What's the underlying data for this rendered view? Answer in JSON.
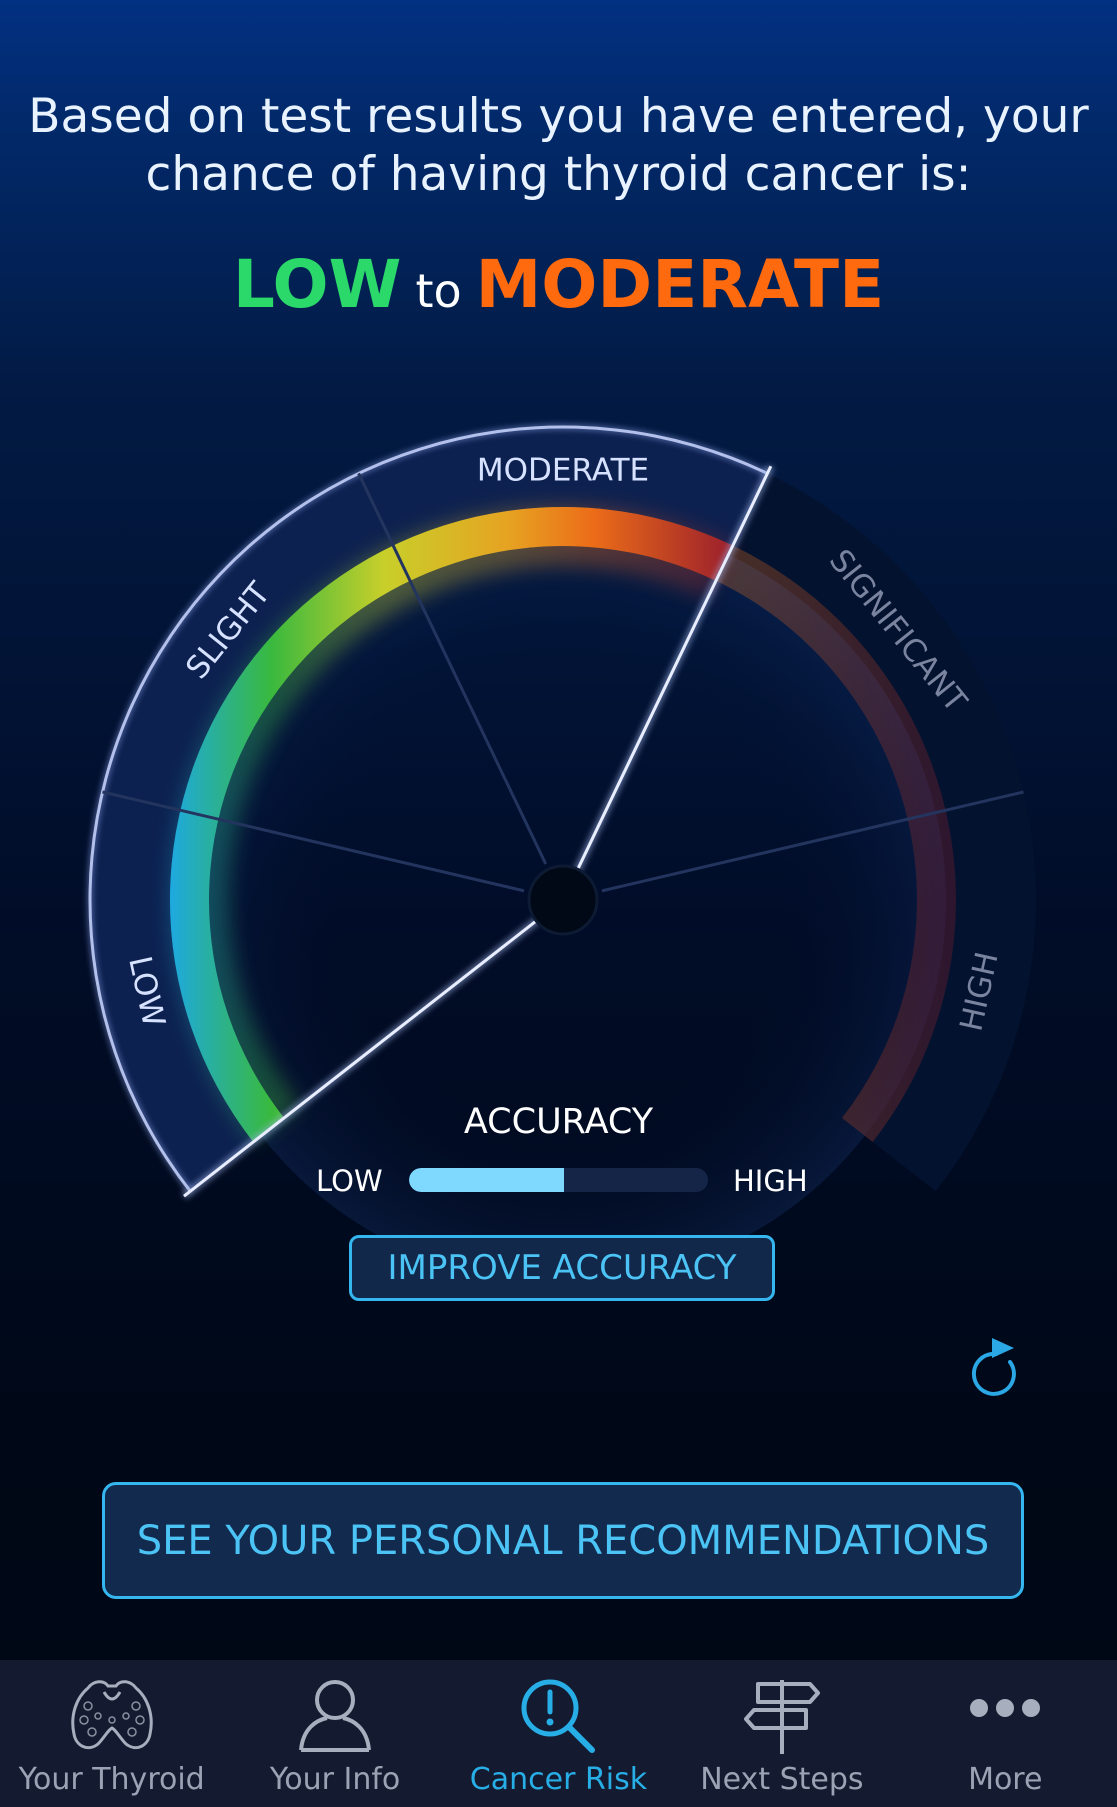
{
  "headline": {
    "line1": "Based on test results you have entered, your",
    "line2": "chance of having thyroid cancer is:"
  },
  "verdict": {
    "low": "LOW",
    "to": "to",
    "moderate": "MODERATE"
  },
  "gauge": {
    "segments": [
      {
        "label": "LOW"
      },
      {
        "label": "SLIGHT"
      },
      {
        "label": "MODERATE"
      },
      {
        "label": "SIGNIFICANT"
      },
      {
        "label": "HIGH"
      }
    ],
    "highlighted_range": [
      "LOW",
      "MODERATE"
    ]
  },
  "accuracy": {
    "title": "ACCURACY",
    "low_label": "LOW",
    "high_label": "HIGH",
    "level": 0.52
  },
  "buttons": {
    "improve": "IMPROVE ACCURACY",
    "recommendations": "SEE YOUR PERSONAL RECOMMENDATIONS"
  },
  "colors": {
    "low": "#2bd96b",
    "moderate": "#ff6a0e",
    "accent": "#35b6ee",
    "tab_active": "#28aee6",
    "tab_inactive": "#9aa2b4"
  },
  "tabs": [
    {
      "label": "Your Thyroid",
      "icon": "thyroid-icon",
      "active": false
    },
    {
      "label": "Your Info",
      "icon": "person-icon",
      "active": false
    },
    {
      "label": "Cancer Risk",
      "icon": "magnifier-alert-icon",
      "active": true
    },
    {
      "label": "Next Steps",
      "icon": "signpost-icon",
      "active": false
    },
    {
      "label": "More",
      "icon": "more-dots-icon",
      "active": false
    }
  ]
}
